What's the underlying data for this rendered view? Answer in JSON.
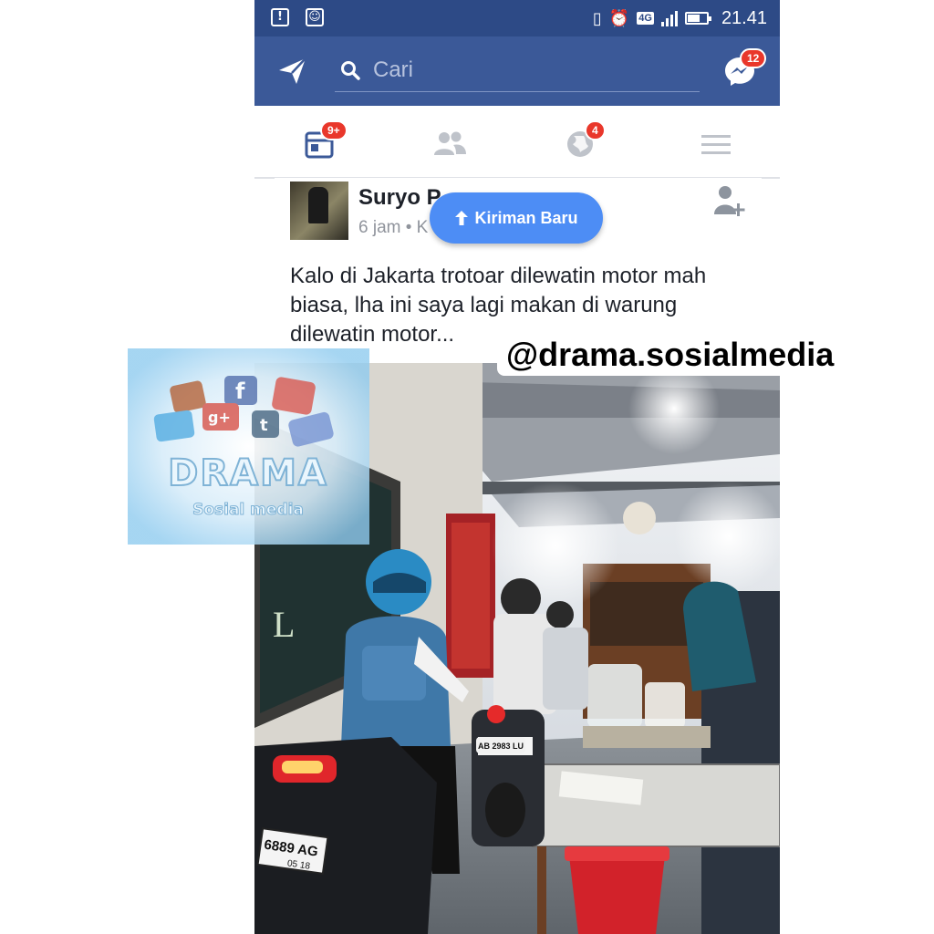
{
  "status_bar": {
    "time": "21.41",
    "network": "4G"
  },
  "app_bar": {
    "search_placeholder": "Cari",
    "messenger_badge": "12"
  },
  "tabs": [
    {
      "name": "news-feed",
      "badge": "9+"
    },
    {
      "name": "friend-requests",
      "badge": ""
    },
    {
      "name": "notifications",
      "badge": "4"
    },
    {
      "name": "menu",
      "badge": ""
    }
  ],
  "post": {
    "author": "Suryo P",
    "meta": "6 jam • K",
    "text": "Kalo di Jakarta trotoar dilewatin motor mah biasa, lha ini saya lagi makan di warung dilewatin motor..."
  },
  "new_posts_button": {
    "label": "Kiriman Baru"
  },
  "watermark": {
    "handle": "@drama.sosialmedia",
    "logo_title": "DRAMA",
    "logo_subtitle": "Sosial media"
  },
  "photo": {
    "plate_1": "6889 AG",
    "plate_1_sub": "05 18",
    "plate_2": "AB 2983 LU"
  },
  "colors": {
    "facebook_blue": "#3b5998",
    "status_bar": "#2d4a86",
    "badge_red": "#e9372b",
    "pill_blue": "#4d8df5"
  }
}
